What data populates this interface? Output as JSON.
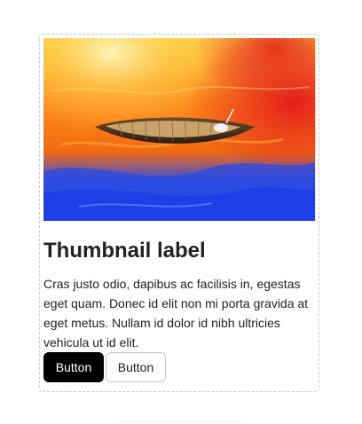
{
  "thumbnail": {
    "title": "Thumbnail label",
    "description": "Cras justo odio, dapibus ac facilisis in, egestas eget quam. Donec id elit non mi porta gravida at eget metus. Nullam id dolor id nibh ultricies vehicula ut id elit.",
    "image_subject": "boat-on-colorful-water",
    "primary_button_label": "Button",
    "secondary_button_label": "Button"
  },
  "colors": {
    "primary_button": "#000000",
    "card_border": "#c9c9c9"
  }
}
